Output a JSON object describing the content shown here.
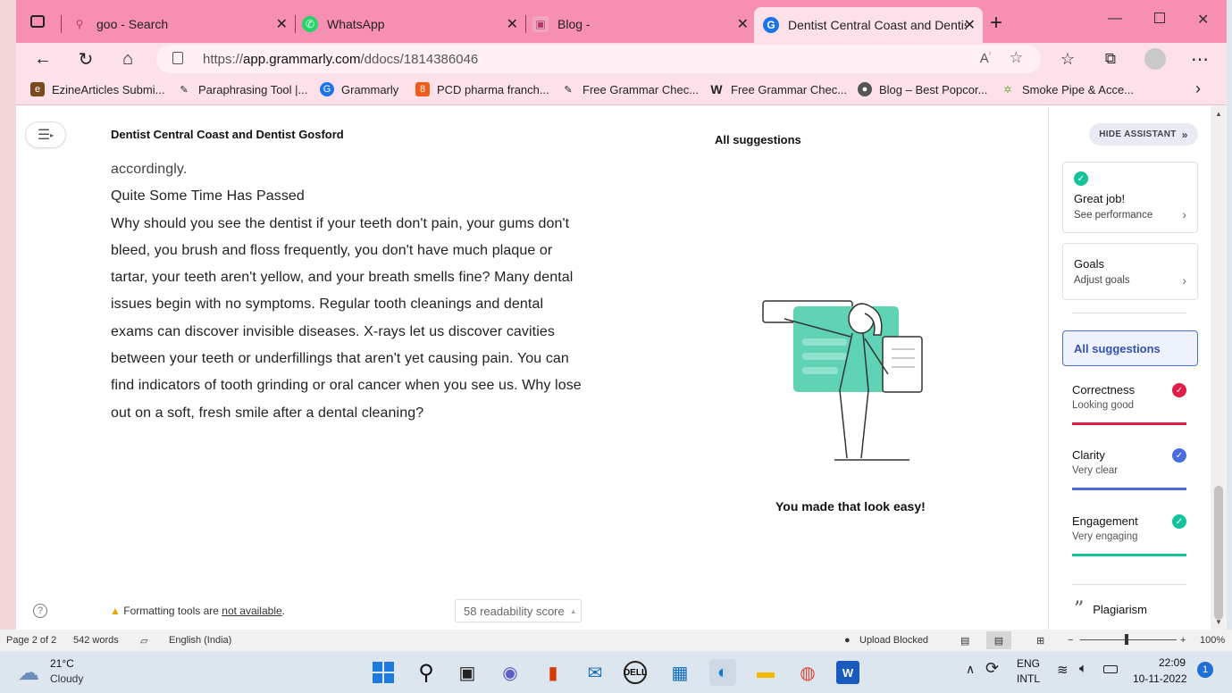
{
  "tabs": [
    {
      "label": "goo - Search",
      "icon": "search-icon"
    },
    {
      "label": "WhatsApp",
      "icon": "whatsapp-icon"
    },
    {
      "label": "Blog -",
      "icon": "blog-icon"
    },
    {
      "label": "Dentist Central Coast and Dentis",
      "icon": "grammarly-icon",
      "active": true
    }
  ],
  "new_tab_label": "+",
  "address": {
    "prefix": "https://",
    "host": "app.grammarly.com",
    "path": "/ddocs/1814386046"
  },
  "bookmarks": [
    {
      "label": "EzineArticles Submi...",
      "icon": "ezine-icon"
    },
    {
      "label": "Paraphrasing Tool |...",
      "icon": "quill-icon"
    },
    {
      "label": "Grammarly",
      "icon": "grammarly-icon"
    },
    {
      "label": "PCD pharma franch...",
      "icon": "pharma-icon"
    },
    {
      "label": "Free Grammar Chec...",
      "icon": "quill-icon"
    },
    {
      "label": "Free Grammar Chec...",
      "icon": "w-icon"
    },
    {
      "label": "Blog – Best Popcor...",
      "icon": "popcorn-icon"
    },
    {
      "label": "Smoke Pipe & Acce...",
      "icon": "leaf-icon"
    }
  ],
  "document": {
    "title": "Dentist Central Coast and Dentist Gosford",
    "lines": [
      "accordingly.",
      "Quite Some Time Has Passed",
      "Why should you see the dentist if your teeth don't pain, your gums don't",
      "bleed, you brush and floss frequently, you don't have much plaque or",
      "tartar, your teeth aren't yellow, and your breath smells fine? Many dental",
      "issues begin with no symptoms. Regular tooth cleanings and dental",
      "exams can discover invisible diseases. X-rays let us discover cavities",
      "between your teeth or underfillings that aren't yet causing pain. You can",
      "find indicators of tooth grinding or oral cancer when you see us. Why lose",
      "out on a soft, fresh smile after a dental cleaning?"
    ],
    "suggestions_heading": "All suggestions",
    "success_message": "You made that look easy!",
    "format_warning_prefix": "Formatting tools are ",
    "format_warning_link": "not available",
    "format_warning_suffix": ".",
    "readability": "58 readability score"
  },
  "sidebar": {
    "hide_assistant": "HIDE ASSISTANT",
    "performance": {
      "title": "Great job!",
      "subtitle": "See performance"
    },
    "goals": {
      "title": "Goals",
      "subtitle": "Adjust goals"
    },
    "all_suggestions": "All suggestions",
    "metrics": [
      {
        "title": "Correctness",
        "subtitle": "Looking good",
        "color": "#e11d48"
      },
      {
        "title": "Clarity",
        "subtitle": "Very clear",
        "color": "#4a6ee0"
      },
      {
        "title": "Engagement",
        "subtitle": "Very engaging",
        "color": "#15c39a"
      }
    ],
    "plagiarism": "Plagiarism"
  },
  "statusbar": {
    "page": "Page 2 of 2",
    "words": "542 words",
    "language": "English (India)",
    "upload": "Upload Blocked",
    "zoom": "100%"
  },
  "taskbar": {
    "temp": "21°C",
    "weather": "Cloudy",
    "lang1": "ENG",
    "lang2": "INTL",
    "time": "22:09",
    "date": "10-11-2022",
    "notifications": "1"
  }
}
